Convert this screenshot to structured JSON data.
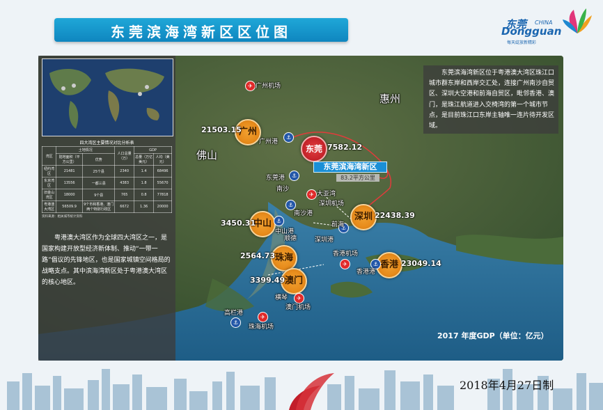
{
  "title": "东莞滨海湾新区区位图",
  "logo": {
    "cn": "东莞",
    "en": "Dongguan",
    "china": "CHINA",
    "slogan": "每天绽放新精彩"
  },
  "left_table": {
    "title": "四大湾区主要情况对比分析表",
    "group_headers": [
      "湾区",
      "土地情况",
      "人口总量（万）",
      "GDP"
    ],
    "sub_headers": [
      "陆地面积（平方公里）",
      "优势",
      "总量（万亿美元）",
      "人均（美元）"
    ],
    "rows": [
      [
        "纽约湾区",
        "21481",
        "25个县",
        "2340",
        "1.4",
        "68496"
      ],
      [
        "东京湾区",
        "13556",
        "一都三县",
        "4383",
        "1.8",
        "55670"
      ],
      [
        "旧金山湾区",
        "18000",
        "9个县",
        "765",
        "0.8",
        "77818"
      ],
      [
        "粤港澳大湾区",
        "56509.9",
        "9个市和香港、澳门两个特别行政区",
        "6672",
        "1.36",
        "20000"
      ]
    ],
    "note": "资料来源：相关城市统计资料"
  },
  "left_text": "粤港澳大湾区作为全球四大湾区之一，是国家构建开放型经济新体制、推动“一带一路”倡议的先锋地区，也是国家城镇空间格局的战略支点。其中滨海湾新区处于粤港澳大湾区的核心地区。",
  "right_text": "东莞滨海湾新区位于粤港澳大湾区珠江口城市群东岸和西岸交汇处，连接广州南沙自贸区、深圳大空港和前海自贸区，毗邻香港、澳门，是珠江航道进入交椅湾的第一个城市节点，是目前珠江口东岸主轴唯一连片待开发区域。",
  "cities": [
    {
      "name": "广州",
      "gdp": "21503.15"
    },
    {
      "name": "东莞",
      "gdp": "7582.12"
    },
    {
      "name": "深圳",
      "gdp": "22438.39"
    },
    {
      "name": "中山",
      "gdp": "3450.31"
    },
    {
      "name": "珠海",
      "gdp": "2564.73"
    },
    {
      "name": "澳门",
      "gdp": "3399.49"
    },
    {
      "name": "香港",
      "gdp": "23049.14"
    }
  ],
  "zone": {
    "name": "东莞滨海湾新区",
    "area": "83.2平方公里"
  },
  "regions": {
    "foshan": "佛山",
    "huizhou": "惠州"
  },
  "airports": [
    "广州机场",
    "深圳机场",
    "香港机场",
    "澳门机场",
    "珠海机场"
  ],
  "ports": [
    "广州港",
    "东莞港",
    "南沙港",
    "中山港",
    "深圳港",
    "香港港",
    "高栏港"
  ],
  "places": [
    "南沙",
    "前海",
    "大亚湾",
    "横琴",
    "顺德"
  ],
  "gdp_note": "2017 年度GDP（单位：亿元）",
  "date": "2018年4月27日制"
}
